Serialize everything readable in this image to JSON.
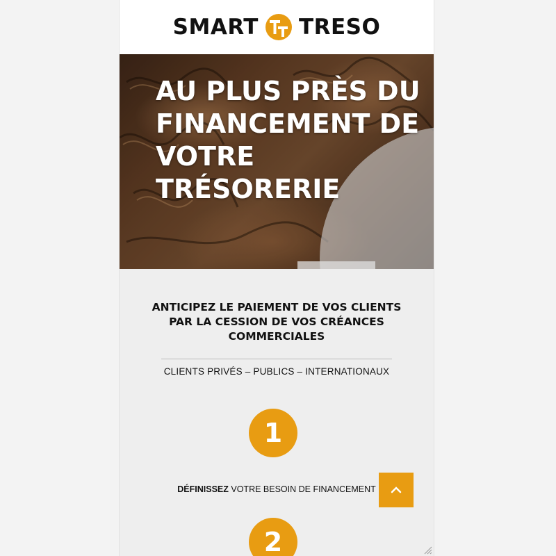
{
  "brand": {
    "name_left": "SMART",
    "name_right": "TRESO",
    "logo_icon": "tt-monogram-icon",
    "accent_color": "#e89c12"
  },
  "hero": {
    "title": "AU PLUS PRÈS DU FINANCEMENT DE VOTRE TRÉSORERIE"
  },
  "intro": {
    "tagline": "ANTICIPEZ LE PAIEMENT DE VOS CLIENTS PAR LA CESSION DE VOS CRÉANCES COMMERCIALES",
    "client_types": "CLIENTS PRIVÉS – PUBLICS – INTERNATIONAUX"
  },
  "steps": [
    {
      "number": "1",
      "label_bold": "DÉFINISSEZ",
      "label_rest": "VOTRE BESOIN DE FINANCEMENT"
    },
    {
      "number": "2"
    }
  ],
  "controls": {
    "scroll_top_icon": "chevron-up-icon"
  }
}
